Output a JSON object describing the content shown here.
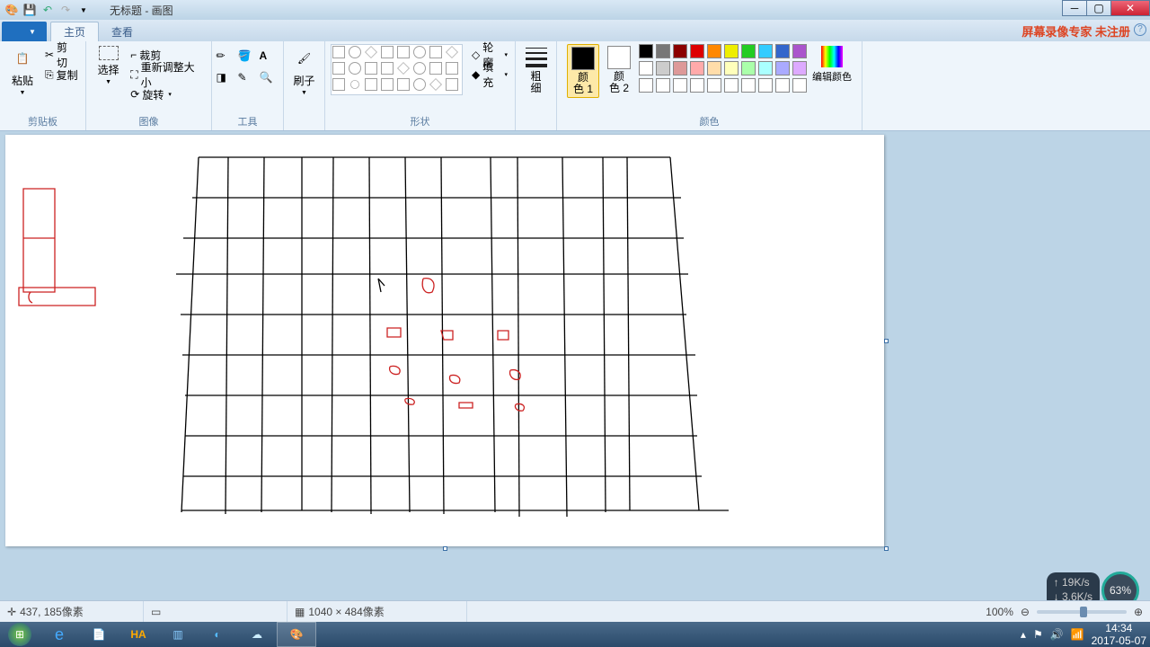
{
  "title": "无标题 - 画图",
  "watermark": "屏幕录像专家 未注册",
  "tabs": {
    "file": "",
    "home": "主页",
    "view": "查看"
  },
  "groups": {
    "clipboard": {
      "label": "剪贴板",
      "paste": "粘贴",
      "cut": "剪切",
      "copy": "复制"
    },
    "image": {
      "label": "图像",
      "select": "选择",
      "crop": "裁剪",
      "resize": "重新调整大小",
      "rotate": "旋转"
    },
    "tools": {
      "label": "工具"
    },
    "brushes": {
      "label": "刷子",
      "btn": "刷子"
    },
    "shapes": {
      "label": "形状",
      "outline": "轮廓",
      "fill": "填充"
    },
    "size": {
      "label": "粗细",
      "btn": "粗\n细"
    },
    "colors": {
      "label": "颜色",
      "c1": "颜\n色 1",
      "c2": "颜\n色 2",
      "edit": "编辑颜色"
    }
  },
  "palette_row1": [
    "#000",
    "#777",
    "#8b0000",
    "#d00",
    "#f80",
    "#ee0",
    "#2c2",
    "#3cf",
    "#36c",
    "#a5c"
  ],
  "palette_row2": [
    "#fff",
    "#ccc",
    "#d99",
    "#faa",
    "#fda",
    "#ffb",
    "#afa",
    "#aff",
    "#aaf",
    "#daf"
  ],
  "status": {
    "pos": "437, 185像素",
    "dim": "1040 × 484像素",
    "zoom": "100%"
  },
  "tray": {
    "up": "19K/s",
    "dn": "3.6K/s",
    "bat": "63%",
    "time": "14:34",
    "date": "2017-05-07"
  }
}
